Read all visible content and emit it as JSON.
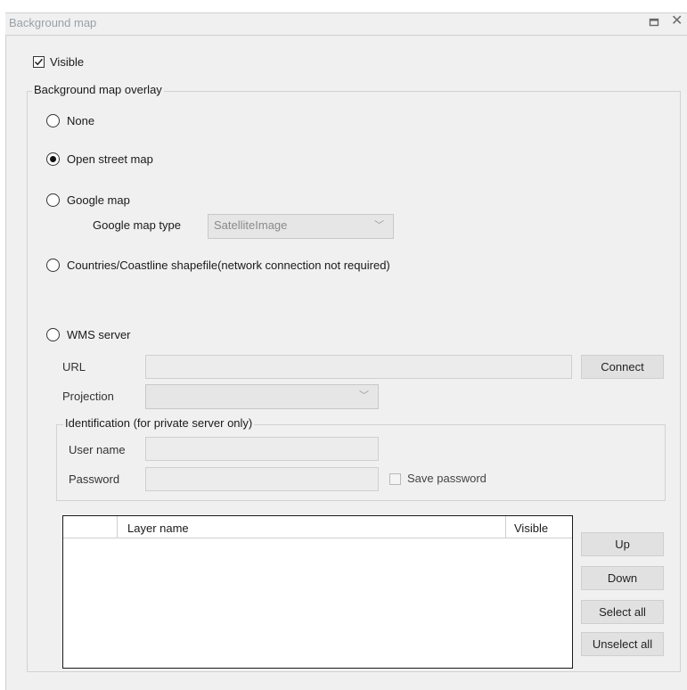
{
  "window": {
    "title": "Background map",
    "close_symbol": "✕"
  },
  "visible_checkbox": {
    "label": "Visible",
    "checked": true
  },
  "overlay_group": {
    "title": "Background map overlay",
    "options": {
      "none": {
        "label": "None",
        "selected": false
      },
      "osm": {
        "label": "Open street map",
        "selected": true
      },
      "google": {
        "label": "Google map",
        "selected": false
      },
      "countries": {
        "label": "Countries/Coastline shapefile(network connection not required)",
        "selected": false
      },
      "wms": {
        "label": "WMS server",
        "selected": false
      }
    },
    "google_map_type": {
      "label": "Google map type",
      "value": "SatelliteImage"
    }
  },
  "wms": {
    "url_label": "URL",
    "url_value": "",
    "connect_label": "Connect",
    "projection_label": "Projection",
    "projection_value": "",
    "identification": {
      "title": "Identification (for private server only)",
      "username_label": "User name",
      "password_label": "Password",
      "save_password_label": "Save password"
    },
    "table": {
      "columns": [
        "",
        "Layer name",
        "Visible"
      ],
      "rows": []
    },
    "buttons": {
      "up": "Up",
      "down": "Down",
      "select_all": "Select all",
      "unselect_all": "Unselect all"
    }
  },
  "icons": {
    "maximize": "maximize-icon",
    "close": "close-icon",
    "chevron": "chevron-down-icon"
  }
}
